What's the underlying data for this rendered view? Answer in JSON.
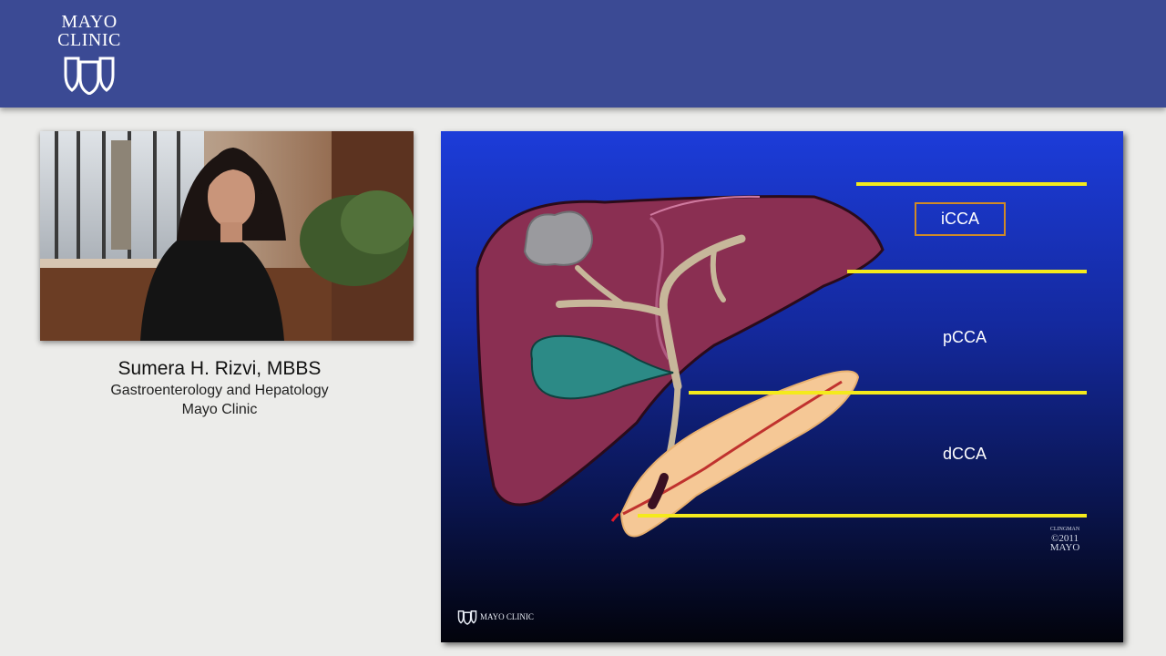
{
  "header": {
    "logo_line1": "MAYO",
    "logo_line2": "CLINIC",
    "logo_icon": "mayo-shields-icon",
    "background_color": "#3b4a94"
  },
  "speaker": {
    "name": "Sumera H. Rizvi, MBBS",
    "department": "Gastroenterology and Hepatology",
    "organization": "Mayo Clinic"
  },
  "slide": {
    "labels": {
      "icca": "iCCA",
      "pcca": "pCCA",
      "dcca": "dCCA"
    },
    "credit_artist": "CLINGMAN",
    "credit_year": "©2011",
    "credit_org": "MAYO",
    "footer_logo": "MAYO CLINIC",
    "line_color": "#f4ea1c",
    "box_color": "#d08a26"
  }
}
